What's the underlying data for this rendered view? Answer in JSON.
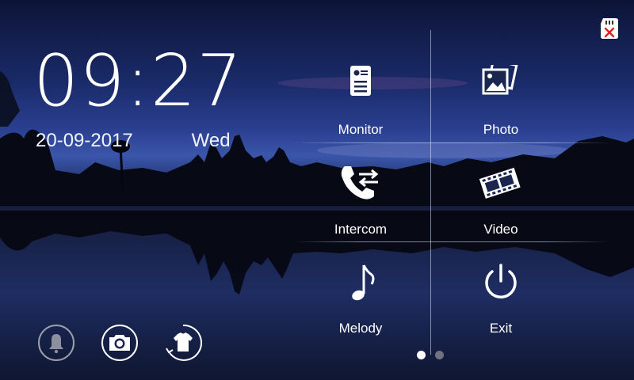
{
  "clock": {
    "time": "09:27",
    "date": "20-09-2017",
    "weekday": "Wed"
  },
  "status": {
    "sdcard_icon": "sdcard-missing-icon"
  },
  "menu": [
    {
      "id": "monitor",
      "label": "Monitor",
      "icon": "monitor-icon"
    },
    {
      "id": "photo",
      "label": "Photo",
      "icon": "photo-icon"
    },
    {
      "id": "intercom",
      "label": "Intercom",
      "icon": "intercom-icon"
    },
    {
      "id": "video",
      "label": "Video",
      "icon": "video-icon"
    },
    {
      "id": "melody",
      "label": "Melody",
      "icon": "melody-icon"
    },
    {
      "id": "exit",
      "label": "Exit",
      "icon": "power-icon"
    }
  ],
  "bottom_bar": [
    {
      "id": "bell",
      "icon": "bell-icon",
      "enabled": false
    },
    {
      "id": "camera",
      "icon": "camera-icon",
      "enabled": true
    },
    {
      "id": "theme",
      "icon": "shirt-icon",
      "enabled": true
    }
  ],
  "pager": {
    "pages": 2,
    "current": 1
  },
  "colors": {
    "text": "#ffffff",
    "sdcard_alert": "#e02020",
    "dot_inactive": "#6f7380"
  }
}
